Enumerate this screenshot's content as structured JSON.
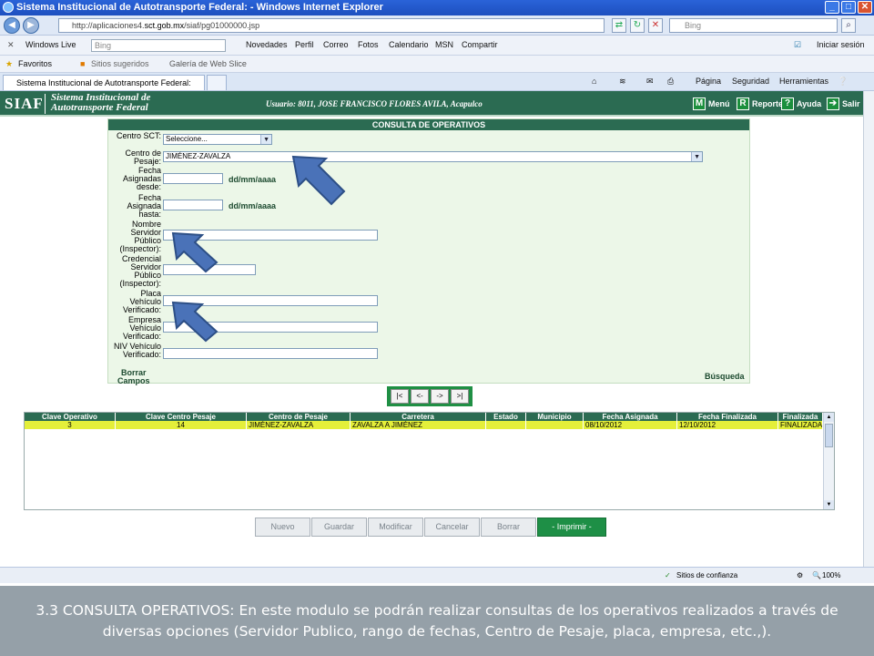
{
  "browser": {
    "title": "Sistema Institucional de Autotransporte Federal: - Windows Internet Explorer",
    "url_prefix": "http://aplicaciones4.",
    "url_host": "sct.gob.mx",
    "url_path": "/siaf/pg01000000.jsp",
    "search_placeholder": "Bing",
    "liveSearchPlaceholder": "Bing",
    "windows_live": "Windows Live",
    "live_menu": [
      "Novedades",
      "Perfil",
      "Correo",
      "Fotos",
      "Calendario",
      "MSN",
      "Compartir"
    ],
    "sign_in": "Iniciar sesión",
    "favorites": "Favoritos",
    "suggested_sites": "Sitios sugeridos",
    "web_slice": "Galería de Web Slice",
    "tab_title": "Sistema Institucional de Autotransporte Federal:",
    "commands": [
      "Página",
      "Seguridad",
      "Herramientas"
    ],
    "status_zone": "Sitios de confianza",
    "zoom": "100%"
  },
  "app": {
    "logo": "SIAF",
    "name_line1": "Sistema Institucional de",
    "name_line2": "Autotransporte Federal",
    "user": "Usuario: 8011, JOSE FRANCISCO FLORES AVILA, Acapulco",
    "nav": [
      {
        "icon": "M",
        "label": "Menú"
      },
      {
        "icon": "R",
        "label": "Reporte"
      },
      {
        "icon": "?",
        "label": "Ayuda"
      },
      {
        "icon": "➔",
        "label": "Salir"
      }
    ]
  },
  "form": {
    "title": "CONSULTA DE OPERATIVOS",
    "centro_sct_label": "Centro SCT:",
    "centro_sct_value": "Seleccione...",
    "centro_pesaje_label": "Centro de Pesaje:",
    "centro_pesaje_value": "JIMÉNEZ-ZAVALZA",
    "fecha_desde_label": "Fecha Asignadas desde:",
    "fecha_hasta_label": "Fecha Asignada hasta:",
    "date_format": "dd/mm/aaaa",
    "nombre_label": "Nombre Servidor Público (Inspector):",
    "credencial_label": "Credencial Servidor Público (Inspector):",
    "placa_label": "Placa Vehículo Verificado:",
    "empresa_label": "Empresa Vehículo Verificado:",
    "niv_label": "NIV Vehículo Verificado:",
    "clear_line1": "Borrar",
    "clear_line2": "Campos",
    "search": "Búsqueda"
  },
  "pager": [
    "|<",
    "<-",
    "->",
    ">|"
  ],
  "table": {
    "columns": [
      "Clave Operativo",
      "Clave Centro Pesaje",
      "Centro de Pesaje",
      "Carretera",
      "Estado",
      "Municipio",
      "Fecha Asignada",
      "Fecha Finalizada",
      "Finalizada"
    ],
    "rows": [
      [
        "3",
        "14",
        "JIMÉNEZ-ZAVALZA",
        "ZAVALZA A JIMÉNEZ",
        "",
        "",
        "08/10/2012",
        "12/10/2012",
        "FINALIZADA"
      ]
    ]
  },
  "actions": [
    "Nuevo",
    "Guardar",
    "Modificar",
    "Cancelar",
    "Borrar",
    "- Imprimir -"
  ],
  "caption": "3.3 CONSULTA OPERATIVOS: En este modulo se podrán realizar consultas de los operativos realizados a través de diversas opciones (Servidor Publico, rango de fechas, Centro de Pesaje, placa, empresa, etc.,).",
  "colors": {
    "header_green": "#2b6b52",
    "highlight_row": "#e4ef3a",
    "arrow_blue": "#4a72b8",
    "caption_bg": "#95a0a8"
  }
}
